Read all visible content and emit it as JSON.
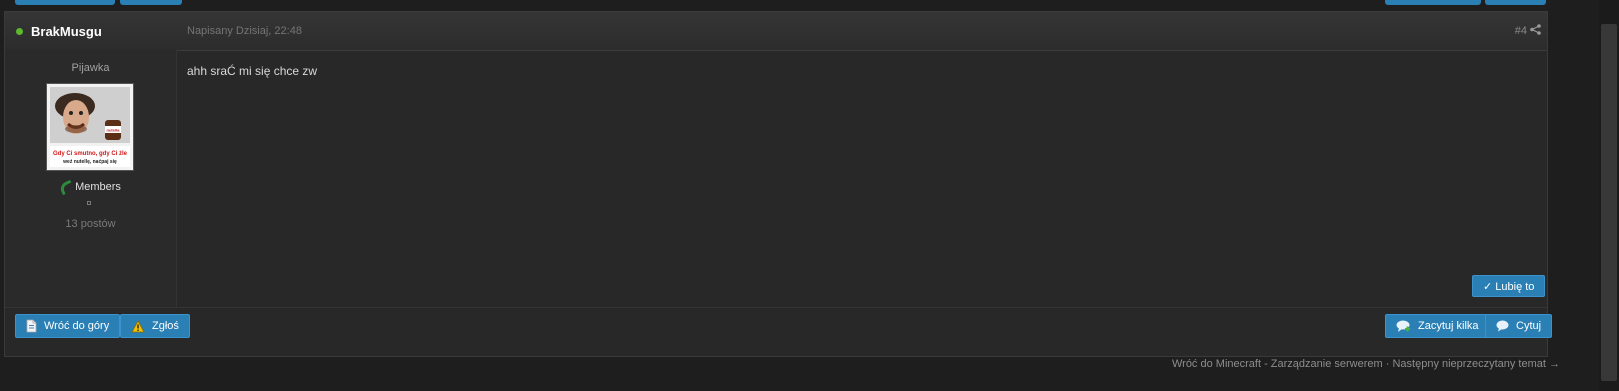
{
  "post": {
    "author": "BrakMusgu",
    "date": "Napisany Dzisiaj, 22:48",
    "number": "#4",
    "body": "ahh sraĆ mi się chce zw",
    "user_title": "Pijawka",
    "group": "Members",
    "post_count": "13 postów",
    "avatar_caption_line1": "Gdy Ci smutno, gdy Ci źle",
    "avatar_caption_line2": "weź nutellę, naćpaj się",
    "like_label": "✓ Lubię to",
    "back_to_top_label": "Wróć do góry",
    "report_label": "Zgłoś",
    "multiquote_label": "Zacytuj kilka",
    "quote_label": "Cytuj"
  },
  "nav": {
    "back_link": "Wróć do Minecraft - Zarządzanie serwerem",
    "separator": "·",
    "next_unread": "Następny nieprzeczytany temat →"
  },
  "colors": {
    "accent": "#2a7fb5",
    "online": "#5cb82c",
    "background": "#1e1e1e",
    "post_background": "#282828"
  },
  "icons": [
    "share-icon",
    "document-icon",
    "warning-icon",
    "multiquote-icon",
    "quote-icon",
    "online-indicator",
    "group-icon"
  ]
}
